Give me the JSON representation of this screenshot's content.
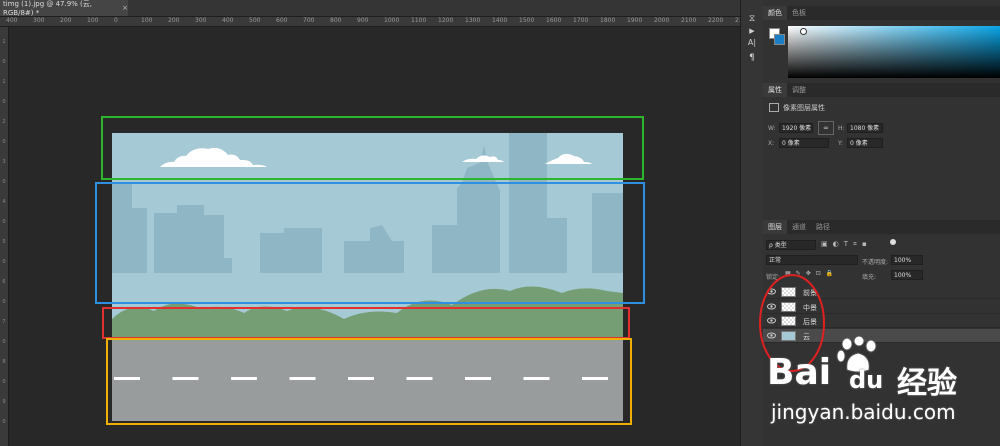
{
  "document": {
    "tab_label": "timg (1).jpg @ 47.9% (云, RGB/8#) *",
    "close_glyph": "×"
  },
  "ruler": {
    "top_ticks": [
      "400",
      "300",
      "200",
      "100",
      "0",
      "100",
      "200",
      "300",
      "400",
      "500",
      "600",
      "700",
      "800",
      "900",
      "1000",
      "1100",
      "1200",
      "1300",
      "1400",
      "1500",
      "1600",
      "1700",
      "1800",
      "1900",
      "2000",
      "2100",
      "2200",
      "2300"
    ],
    "left_ticks": [
      "1",
      "0",
      "1",
      "0",
      "2",
      "0",
      "3",
      "0",
      "4",
      "0",
      "5",
      "0",
      "6",
      "0",
      "7",
      "0",
      "8",
      "0",
      "9",
      "0"
    ]
  },
  "annotation_colors": {
    "sky": "#2db52d",
    "city": "#2f8fe0",
    "bushes": "#e03030",
    "road": "#f0b000",
    "layers": "#e02020"
  },
  "art_colors": {
    "sky": "#a6c9d6",
    "city": "#8fb6c5",
    "bush": "#759e74",
    "road": "#989c9d",
    "dash": "#ffffff",
    "cloud": "#ffffff"
  },
  "strip": {
    "icons": [
      "history-icon",
      "play-icon",
      "character-icon",
      "paragraph-icon"
    ],
    "glyphs": [
      "⧖",
      "▶",
      "A|",
      "¶"
    ]
  },
  "color_panel": {
    "tabs": [
      "颜色",
      "色板"
    ]
  },
  "properties_panel": {
    "tabs": [
      "属性",
      "调整"
    ],
    "title": "像素图层属性",
    "w_label": "W:",
    "w_value": "1920 像素",
    "link_glyph": "∞",
    "h_label": "H:",
    "h_value": "1080 像素",
    "x_label": "X:",
    "x_value": "0 像素",
    "y_label": "Y:",
    "y_value": "0 像素"
  },
  "layers_panel": {
    "tabs": [
      "图层",
      "通道",
      "路径"
    ],
    "filter_label": "ρ 类型",
    "blend_mode": "正常",
    "opacity_label": "不透明度:",
    "opacity_value": "100%",
    "lock_label": "锁定:",
    "fill_label": "填充:",
    "fill_value": "100%",
    "layers": [
      {
        "name": "前景",
        "selected": false
      },
      {
        "name": "中景",
        "selected": false
      },
      {
        "name": "后景",
        "selected": false
      },
      {
        "name": "云",
        "selected": true
      }
    ]
  },
  "watermark": {
    "brand_a": "Bai",
    "brand_b": "du",
    "brand_cn": "经验",
    "url": "jingyan.baidu.com"
  }
}
